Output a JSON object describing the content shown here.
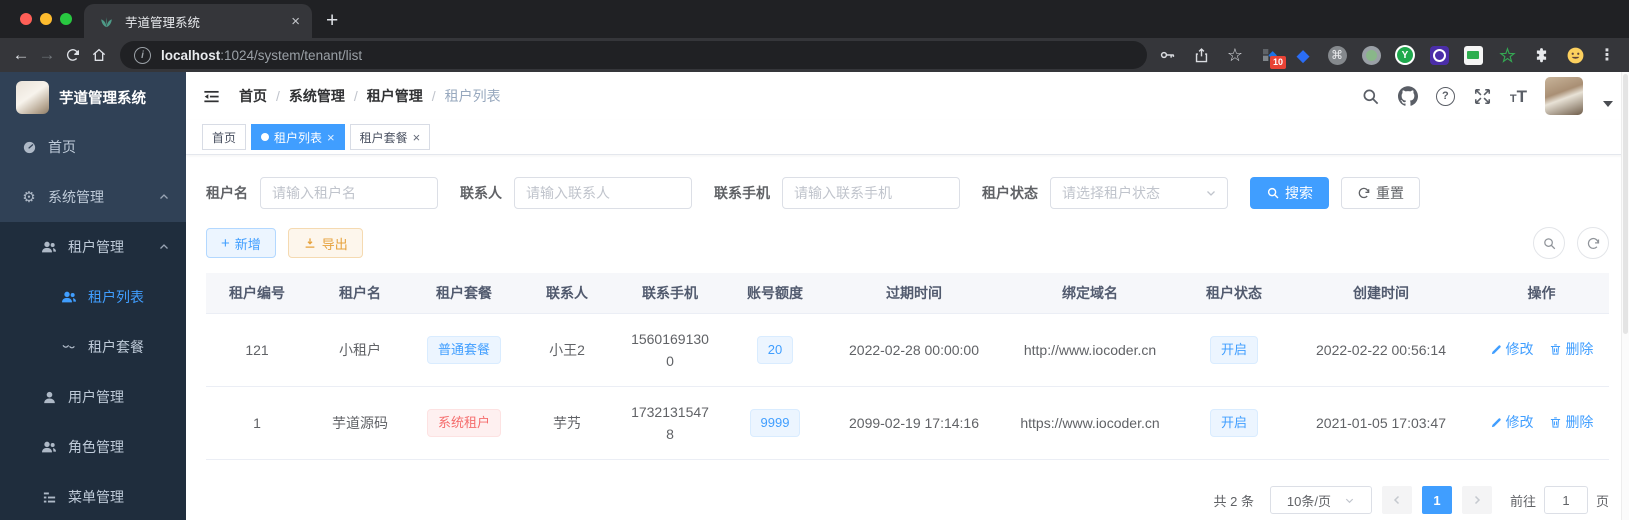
{
  "browser": {
    "tab_title": "芋道管理系统",
    "url_host": "localhost",
    "url_rest": ":1024/system/tenant/list",
    "extension_badge": "10"
  },
  "icons": {
    "favicon": "teal-plant",
    "traffic_lights": [
      "close-red",
      "minimize-yellow",
      "zoom-green"
    ],
    "chrome_toolbar": [
      "back-arrow",
      "forward-arrow",
      "reload",
      "home",
      "info",
      "key",
      "share",
      "bookmark-star",
      "extensions",
      "browser-menu-dots"
    ],
    "app_navbar": [
      "menu-fold",
      "search-magnifier",
      "github-octocat",
      "help-question",
      "fullscreen-arrows",
      "font-size-tT",
      "user-avatar",
      "caret-down"
    ],
    "sidebar": [
      "dashboard-gauge",
      "gear",
      "users",
      "user",
      "peoples",
      "tree-table"
    ],
    "table_actions": [
      "edit-pencil",
      "delete-trash"
    ],
    "list_toolbar": [
      "search-magnifier",
      "refresh"
    ]
  },
  "sidebar": {
    "app_title": "芋道管理系统",
    "menu": [
      {
        "label": "首页"
      },
      {
        "label": "系统管理",
        "children": [
          {
            "label": "租户管理",
            "children": [
              {
                "label": "租户列表",
                "active": true
              },
              {
                "label": "租户套餐"
              }
            ]
          },
          {
            "label": "用户管理"
          },
          {
            "label": "角色管理"
          },
          {
            "label": "菜单管理"
          }
        ]
      }
    ]
  },
  "breadcrumb": {
    "items": [
      "首页",
      "系统管理",
      "租户管理",
      "租户列表"
    ],
    "separator": "/"
  },
  "tags": [
    {
      "label": "首页",
      "active": false,
      "closable": false
    },
    {
      "label": "租户列表",
      "active": true,
      "closable": true
    },
    {
      "label": "租户套餐",
      "active": false,
      "closable": true
    }
  ],
  "search": {
    "tenant_name_label": "租户名",
    "tenant_name_placeholder": "请输入租户名",
    "contact_label": "联系人",
    "contact_placeholder": "请输入联系人",
    "mobile_label": "联系手机",
    "mobile_placeholder": "请输入联系手机",
    "status_label": "租户状态",
    "status_placeholder": "请选择租户状态",
    "search_label": "搜索",
    "reset_label": "重置"
  },
  "actions": {
    "add_label": "新增",
    "export_label": "导出"
  },
  "table": {
    "headers": [
      "租户编号",
      "租户名",
      "租户套餐",
      "联系人",
      "联系手机",
      "账号额度",
      "过期时间",
      "绑定域名",
      "租户状态",
      "创建时间",
      "操作"
    ],
    "rows": [
      {
        "id": "121",
        "name": "小租户",
        "package": "普通套餐",
        "package_type": "primary",
        "contact": "小王2",
        "mobile": "15601691300",
        "quota": "20",
        "expire": "2022-02-28 00:00:00",
        "domain": "http://www.iocoder.cn",
        "status": "开启",
        "created": "2022-02-22 00:56:14"
      },
      {
        "id": "1",
        "name": "芋道源码",
        "package": "系统租户",
        "package_type": "danger",
        "contact": "芋艿",
        "mobile": "17321315478",
        "quota": "9999",
        "expire": "2099-02-19 17:14:16",
        "domain": "https://www.iocoder.cn",
        "status": "开启",
        "created": "2021-01-05 17:03:47"
      }
    ],
    "edit_label": "修改",
    "delete_label": "删除"
  },
  "pagination": {
    "total_text": "共 2 条",
    "page_size": "10条/页",
    "current_page": "1",
    "goto_label": "前往",
    "goto_value": "1",
    "page_unit": "页"
  },
  "colors": {
    "primary": "#409eff",
    "danger": "#f56c6c",
    "warning": "#e6a23c",
    "sidebar_bg": "#304156",
    "submenu_bg": "#1f2d3d",
    "tag_blue_bg": "#ecf5ff",
    "tag_red_bg": "#fef0f0"
  }
}
